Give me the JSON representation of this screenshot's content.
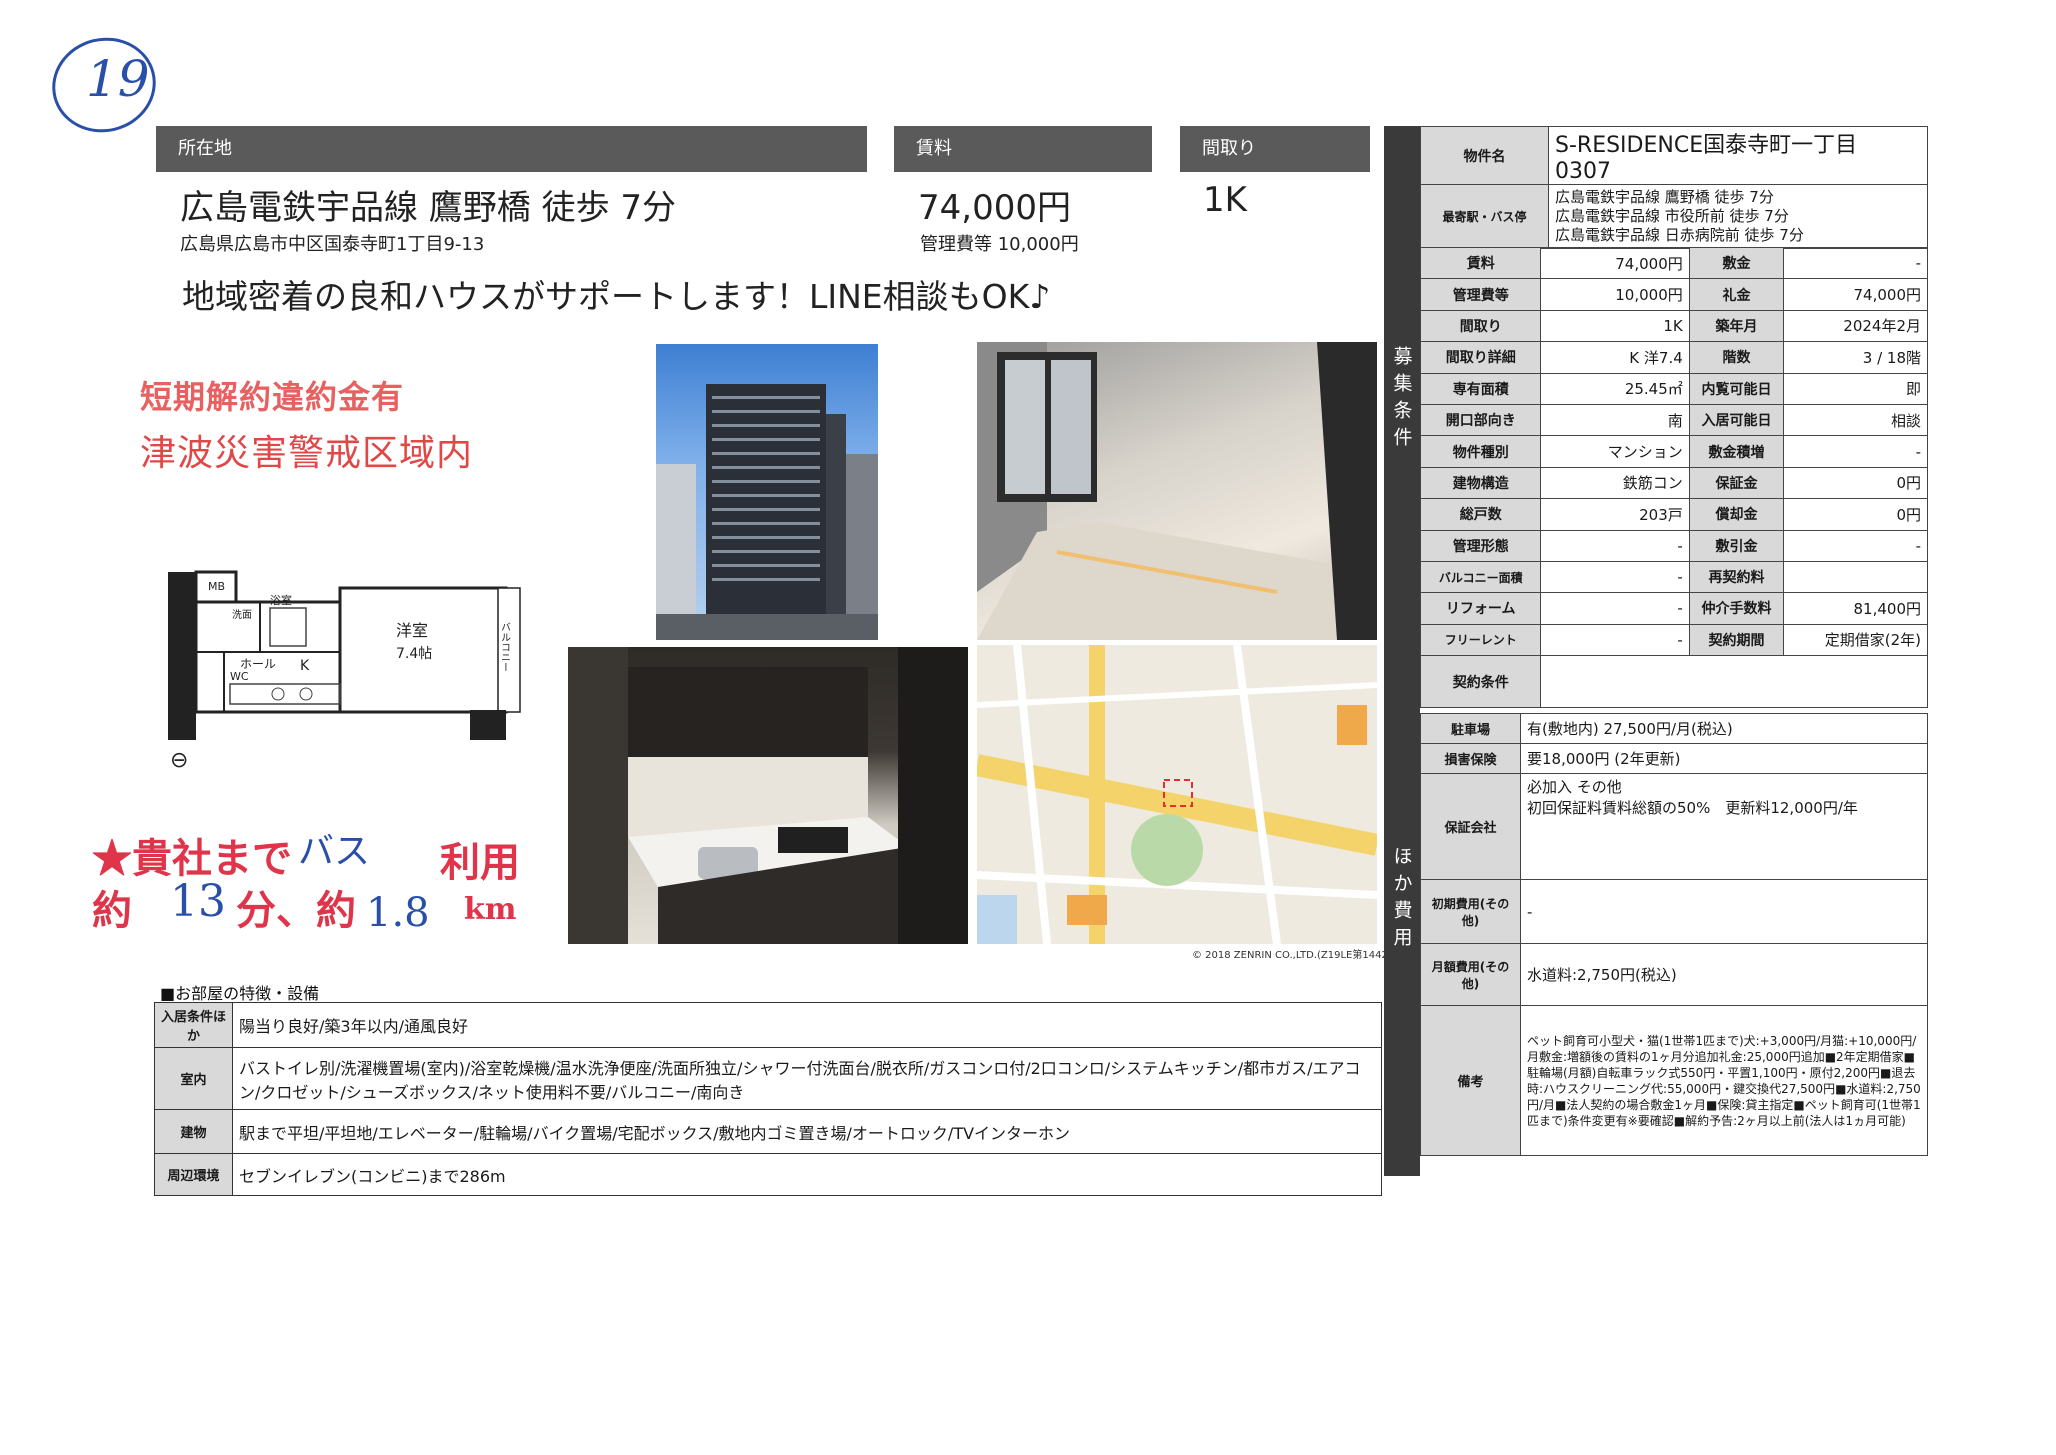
{
  "page_mark": "19",
  "header": {
    "location_label": "所在地",
    "rent_label": "賃料",
    "layout_label": "間取り"
  },
  "summary": {
    "station": "広島電鉄宇品線 鷹野橋 徒歩 7分",
    "address": "広島県広島市中区国泰寺町1丁目9-13",
    "rent": "74,000円",
    "mgmt": "管理費等 10,000円",
    "layout": "1K",
    "promo": "地域密着の良和ハウスがサポートします！LINE相談もOK♪"
  },
  "stamp": {
    "line1": "短期解約違約金有",
    "line2": "津波災害警戒区域内"
  },
  "handwriting": {
    "a": "★貴社まで",
    "b": "バス",
    "c": "利用",
    "d": "約",
    "e": "13",
    "f": "分、約",
    "g": "1.8",
    "h": "km"
  },
  "floorplan": {
    "room": "洋室",
    "size": "7.4帖",
    "mb": "MB",
    "hall": "ホール",
    "k": "K",
    "wc": "WC",
    "bath": "浴室",
    "wash": "洗面",
    "balcony": "バルコニー"
  },
  "map_credit": "© 2018 ZENRIN CO.,LTD.(Z19LE第1442号)",
  "features": {
    "title": "■お部屋の特徴・設備",
    "rows": [
      {
        "k": "入居条件ほか",
        "v": "陽当り良好/築3年以内/通風良好"
      },
      {
        "k": "室内",
        "v": "バストイレ別/洗濯機置場(室内)/浴室乾燥機/温水洗浄便座/洗面所独立/シャワー付洗面台/脱衣所/ガスコンロ付/2口コンロ/システムキッチン/都市ガス/エアコン/クロゼット/シューズボックス/ネット使用料不要/バルコニー/南向き"
      },
      {
        "k": "建物",
        "v": "駅まで平坦/平坦地/エレベーター/駐輪場/バイク置場/宅配ボックス/敷地内ゴミ置き場/オートロック/TVインターホン"
      },
      {
        "k": "周辺環境",
        "v": "セブンイレブン(コンビニ)まで286m"
      }
    ]
  },
  "side": {
    "recruit_label": "募集条件",
    "other_label": "ほか費用",
    "property_name_label": "物件名",
    "property_name": "S-RESIDENCE国泰寺町一丁目　0307",
    "nearest_label": "最寄駅・バス停",
    "nearest": [
      "広島電鉄宇品線 鷹野橋 徒歩 7分",
      "広島電鉄宇品線 市役所前 徒歩 7分",
      "広島電鉄宇品線 日赤病院前 徒歩 7分"
    ],
    "rows": [
      [
        "賃料",
        "74,000円",
        "敷金",
        "-"
      ],
      [
        "管理費等",
        "10,000円",
        "礼金",
        "74,000円"
      ],
      [
        "間取り",
        "1K",
        "築年月",
        "2024年2月"
      ],
      [
        "間取り詳細",
        "K 洋7.4",
        "階数",
        "3 / 18階"
      ],
      [
        "専有面積",
        "25.45㎡",
        "内覧可能日",
        "即"
      ],
      [
        "開口部向き",
        "南",
        "入居可能日",
        "相談"
      ],
      [
        "物件種別",
        "マンション",
        "敷金積増",
        "-"
      ],
      [
        "建物構造",
        "鉄筋コン",
        "保証金",
        "0円"
      ],
      [
        "総戸数",
        "203戸",
        "償却金",
        "0円"
      ],
      [
        "管理形態",
        "-",
        "敷引金",
        "-"
      ],
      [
        "バルコニー面積",
        "-",
        "再契約料",
        ""
      ],
      [
        "リフォーム",
        "-",
        "仲介手数料",
        "81,400円"
      ],
      [
        "フリーレント",
        "-",
        "契約期間",
        "定期借家(2年)"
      ]
    ],
    "contract_label": "契約条件",
    "contract": ""
  },
  "other": {
    "parking_label": "駐車場",
    "parking": "有(敷地内) 27,500円/月(税込)",
    "insurance_label": "損害保険",
    "insurance": "要18,000円 (2年更新)",
    "guarantor_label": "保証会社",
    "guarantor_1": "必加入 その他",
    "guarantor_2": "初回保証料賃料総額の50%　更新料12,000円/年",
    "initial_label": "初期費用(その他)",
    "initial": "-",
    "monthly_label": "月額費用(その他)",
    "monthly": "水道料:2,750円(税込)",
    "remarks_label": "備考",
    "remarks": "ペット飼育可小型犬・猫(1世帯1匹まで)犬:+3,000円/月猫:+10,000円/月敷金:増額後の賃料の1ヶ月分追加礼金:25,000円追加■2年定期借家■駐輪場(月額)自転車ラック式550円・平置1,100円・原付2,200円■退去時:ハウスクリーニング代:55,000円・鍵交換代27,500円■水道料:2,750円/月■法人契約の場合敷金1ヶ月■保険:貸主指定■ペット飼育可(1世帯1匹まで)条件変更有※要確認■解約予告:2ヶ月以上前(法人は1ヵ月可能)"
  }
}
